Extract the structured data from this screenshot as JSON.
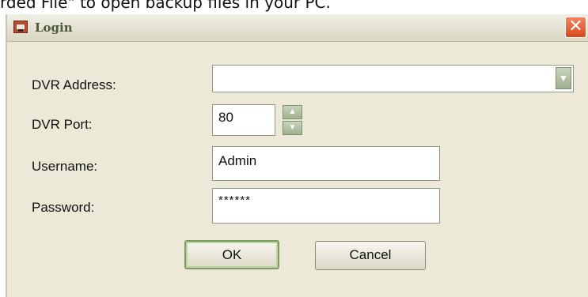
{
  "background": {
    "text": "rded File\" to open backup files in your PC."
  },
  "window": {
    "title": "Login",
    "close_label": "✕"
  },
  "form": {
    "address": {
      "label": "DVR Address:",
      "value": ""
    },
    "port": {
      "label": "DVR Port:",
      "value": "80"
    },
    "username": {
      "label": "Username:",
      "value": "Admin"
    },
    "password": {
      "label": "Password:",
      "value": "******"
    }
  },
  "buttons": {
    "ok": "OK",
    "cancel": "Cancel"
  },
  "colors": {
    "dialog_bg": "#ece9d8",
    "close_red": "#d9471d",
    "control_green": "#9fb08e"
  }
}
